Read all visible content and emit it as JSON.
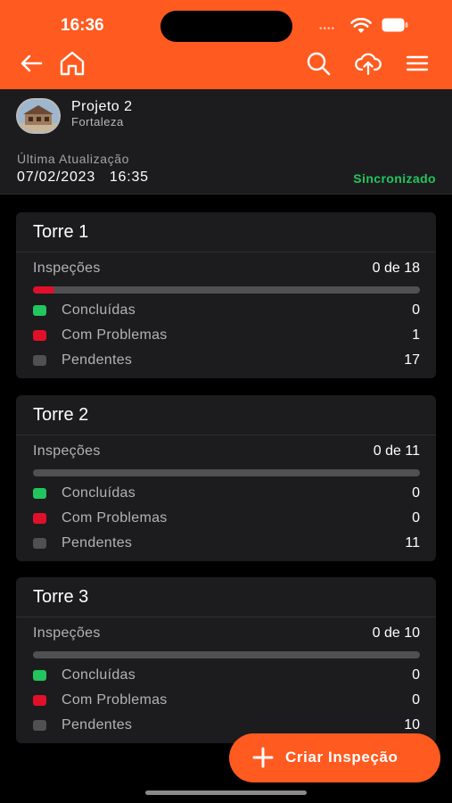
{
  "status_bar": {
    "time": "16:36"
  },
  "header": {
    "icons": [
      "back-arrow-icon",
      "home-icon",
      "search-icon",
      "cloud-upload-icon",
      "hamburger-menu-icon"
    ]
  },
  "project": {
    "name": "Projeto 2",
    "city": "Fortaleza",
    "last_update_label": "Última Atualização",
    "last_update_value": "07/02/2023   16:35",
    "sync_status": "Sincronizado"
  },
  "colors": {
    "accent": "#FF5A1F",
    "done": "#22C55E",
    "problem": "#E0102B",
    "pending": "#505052",
    "background": "#000000",
    "card": "#1C1C1E"
  },
  "towers": [
    {
      "title": "Torre 1",
      "inspections_label": "Inspeções",
      "inspections_count": "0 de 18",
      "progress": {
        "done": 0,
        "problems": 1,
        "total": 18
      },
      "rows": [
        {
          "label": "Concluídas",
          "value": "0",
          "color": "#22C55E"
        },
        {
          "label": "Com Problemas",
          "value": "1",
          "color": "#E0102B"
        },
        {
          "label": "Pendentes",
          "value": "17",
          "color": "#505052"
        }
      ]
    },
    {
      "title": "Torre 2",
      "inspections_label": "Inspeções",
      "inspections_count": "0 de 11",
      "progress": {
        "done": 0,
        "problems": 0,
        "total": 11
      },
      "rows": [
        {
          "label": "Concluídas",
          "value": "0",
          "color": "#22C55E"
        },
        {
          "label": "Com Problemas",
          "value": "0",
          "color": "#E0102B"
        },
        {
          "label": "Pendentes",
          "value": "11",
          "color": "#505052"
        }
      ]
    },
    {
      "title": "Torre 3",
      "inspections_label": "Inspeções",
      "inspections_count": "0 de 10",
      "progress": {
        "done": 0,
        "problems": 0,
        "total": 10
      },
      "rows": [
        {
          "label": "Concluídas",
          "value": "0",
          "color": "#22C55E"
        },
        {
          "label": "Com Problemas",
          "value": "0",
          "color": "#E0102B"
        },
        {
          "label": "Pendentes",
          "value": "10",
          "color": "#505052"
        }
      ]
    }
  ],
  "fab": {
    "label": "Criar Inspeção",
    "icon": "plus-icon"
  }
}
